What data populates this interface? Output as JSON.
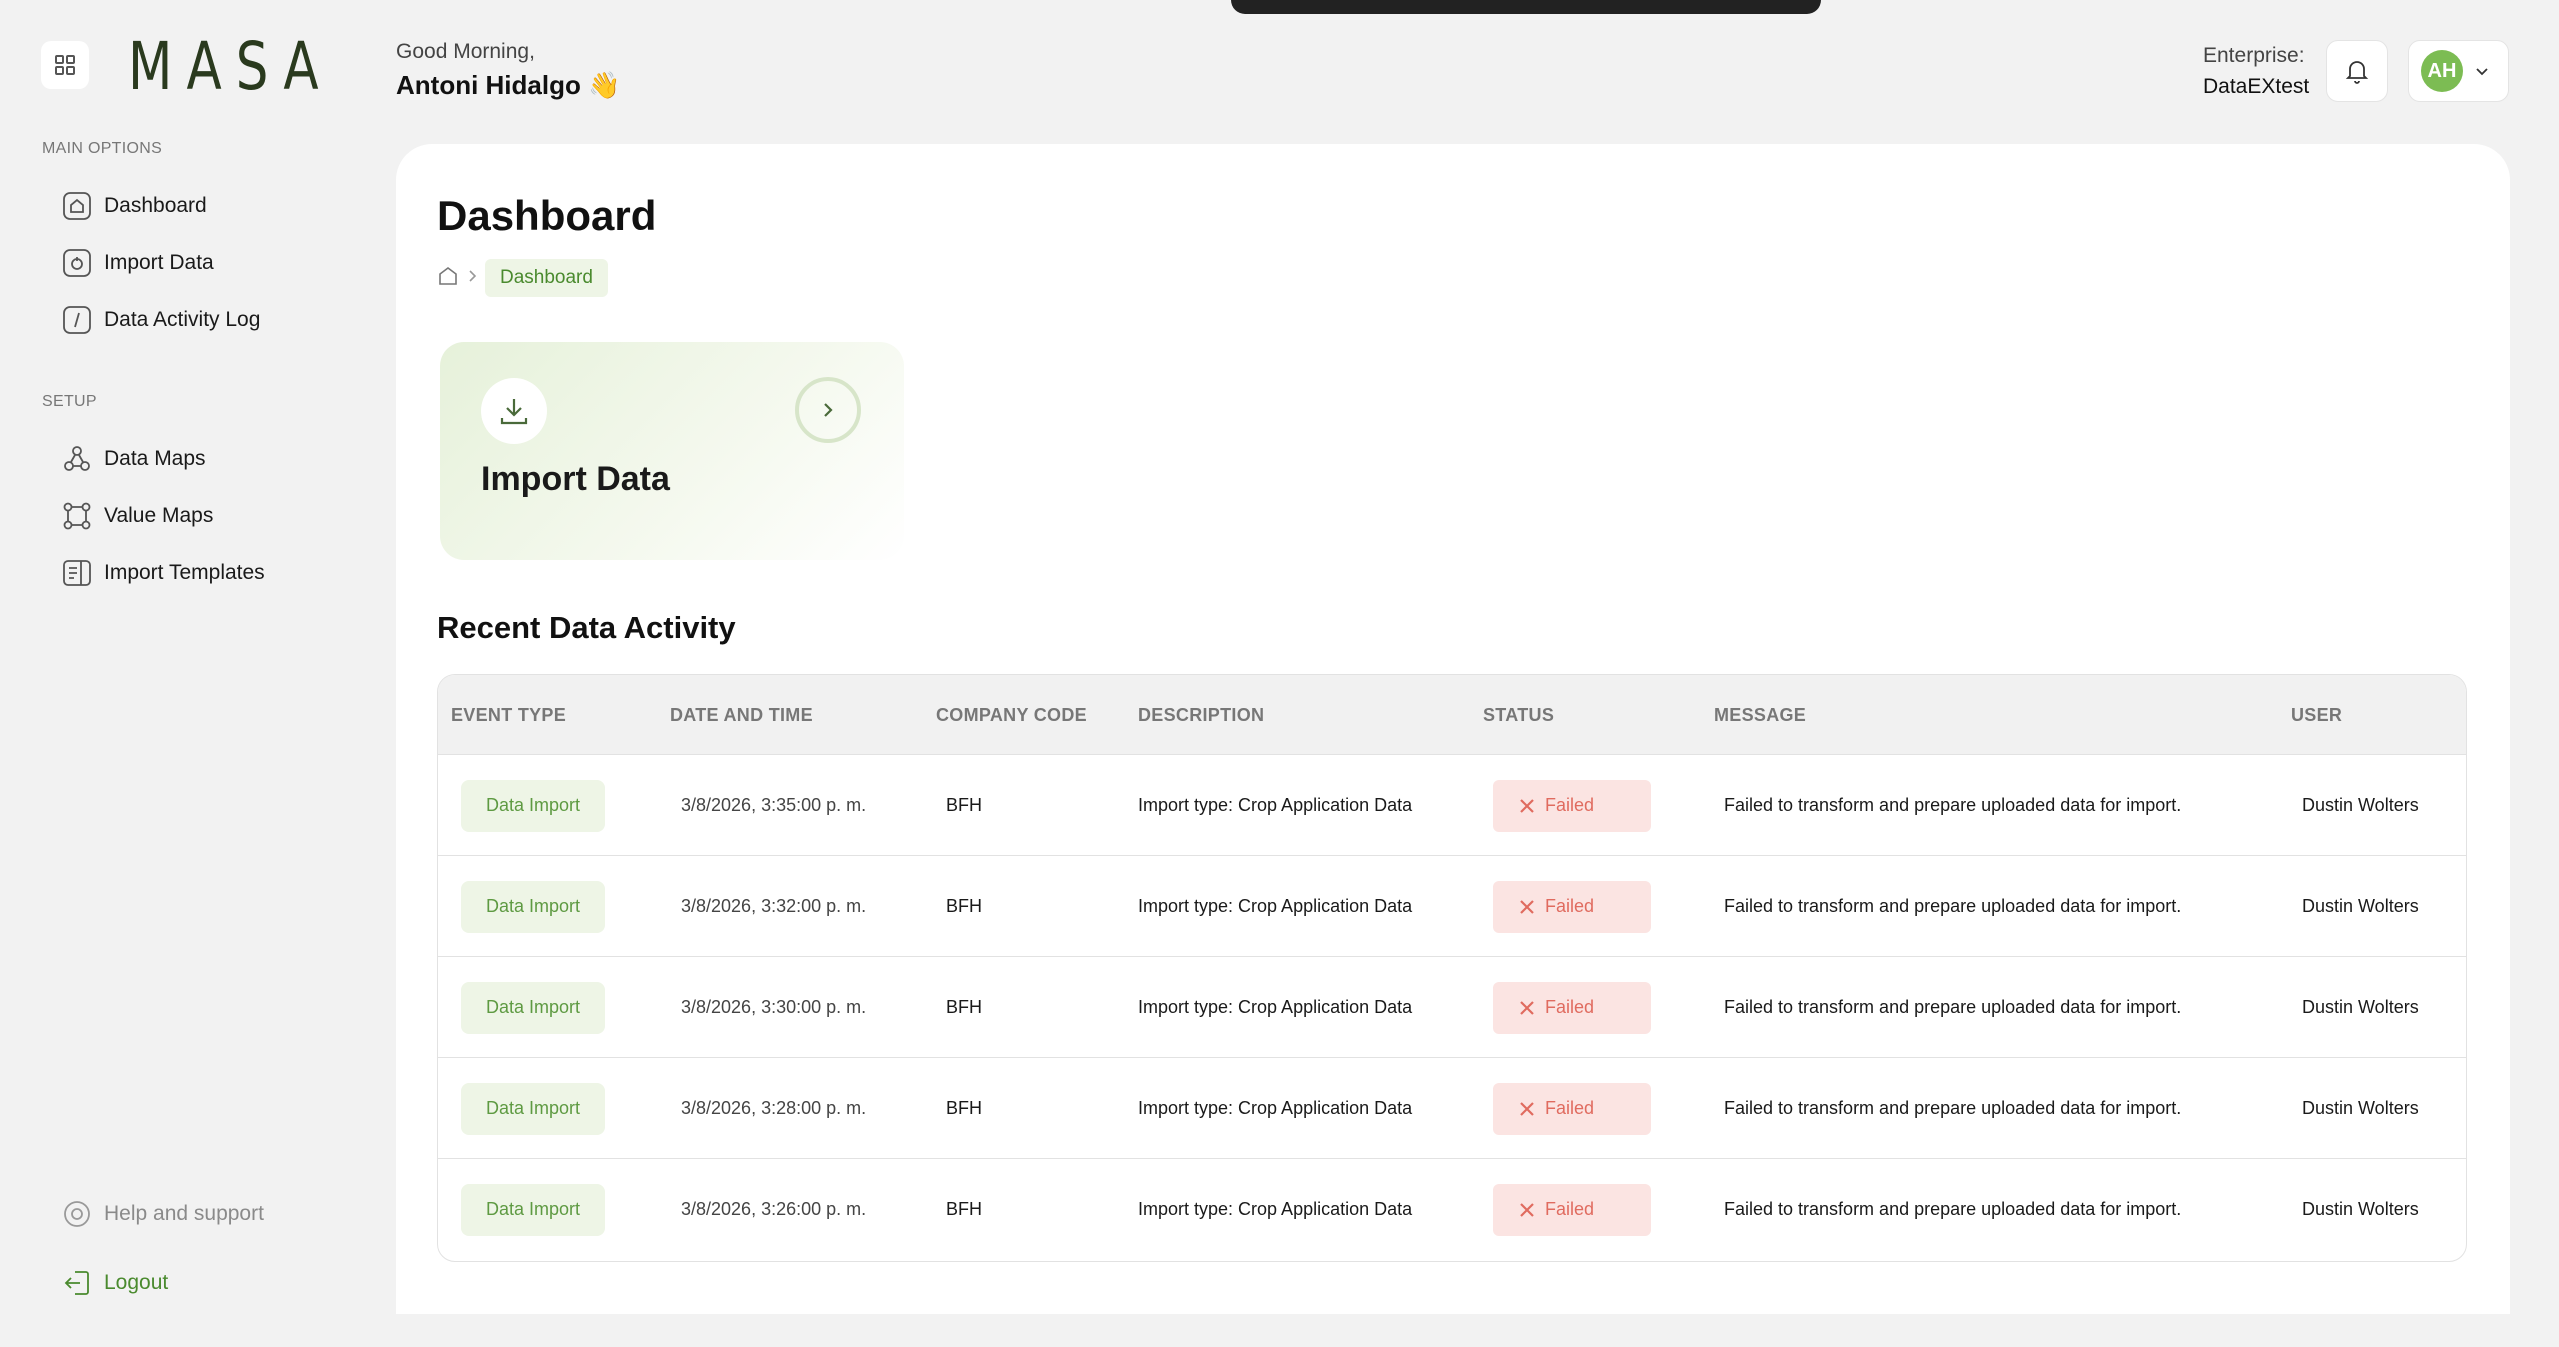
{
  "app": {
    "logo": "MASA"
  },
  "sidebar": {
    "main_options_label": "MAIN OPTIONS",
    "main_items": [
      {
        "label": "Dashboard",
        "icon": "home-icon"
      },
      {
        "label": "Import Data",
        "icon": "folder-upload-icon"
      },
      {
        "label": "Data Activity Log",
        "icon": "log-icon"
      }
    ],
    "setup_label": "SETUP",
    "setup_items": [
      {
        "label": "Data Maps",
        "icon": "nodes-icon"
      },
      {
        "label": "Value Maps",
        "icon": "network-icon"
      },
      {
        "label": "Import Templates",
        "icon": "template-icon"
      }
    ],
    "help_label": "Help and support",
    "logout_label": "Logout"
  },
  "header": {
    "greeting": "Good Morning,",
    "user_name": "Antoni Hidalgo 👋",
    "enterprise_label": "Enterprise:",
    "enterprise_value": "DataEXtest",
    "avatar_initials": "AH"
  },
  "main": {
    "title": "Dashboard",
    "breadcrumb_current": "Dashboard",
    "import_card_label": "Import Data",
    "recent_title": "Recent Data Activity"
  },
  "table": {
    "headers": {
      "event_type": "EVENT TYPE",
      "date_time": "DATE AND TIME",
      "company_code": "COMPANY CODE",
      "description": "DESCRIPTION",
      "status": "STATUS",
      "message": "MESSAGE",
      "user": "USER"
    },
    "rows": [
      {
        "event": "Data Import",
        "date": "3/8/2026, 3:35:00 p. m.",
        "company": "BFH",
        "description": "Import type: Crop Application Data",
        "status": "Failed",
        "message": "Failed to transform and prepare uploaded data for import.",
        "user": "Dustin Wolters"
      },
      {
        "event": "Data Import",
        "date": "3/8/2026, 3:32:00 p. m.",
        "company": "BFH",
        "description": "Import type: Crop Application Data",
        "status": "Failed",
        "message": "Failed to transform and prepare uploaded data for import.",
        "user": "Dustin Wolters"
      },
      {
        "event": "Data Import",
        "date": "3/8/2026, 3:30:00 p. m.",
        "company": "BFH",
        "description": "Import type: Crop Application Data",
        "status": "Failed",
        "message": "Failed to transform and prepare uploaded data for import.",
        "user": "Dustin Wolters"
      },
      {
        "event": "Data Import",
        "date": "3/8/2026, 3:28:00 p. m.",
        "company": "BFH",
        "description": "Import type: Crop Application Data",
        "status": "Failed",
        "message": "Failed to transform and prepare uploaded data for import.",
        "user": "Dustin Wolters"
      },
      {
        "event": "Data Import",
        "date": "3/8/2026, 3:26:00 p. m.",
        "company": "BFH",
        "description": "Import type: Crop Application Data",
        "status": "Failed",
        "message": "Failed to transform and prepare uploaded data for import.",
        "user": "Dustin Wolters"
      }
    ]
  },
  "colors": {
    "accent_green": "#4a8a2e",
    "avatar_green": "#7cbc53",
    "failed_red": "#e06b5f",
    "failed_bg": "#fbe4e2",
    "event_bg": "#eef5e6"
  }
}
